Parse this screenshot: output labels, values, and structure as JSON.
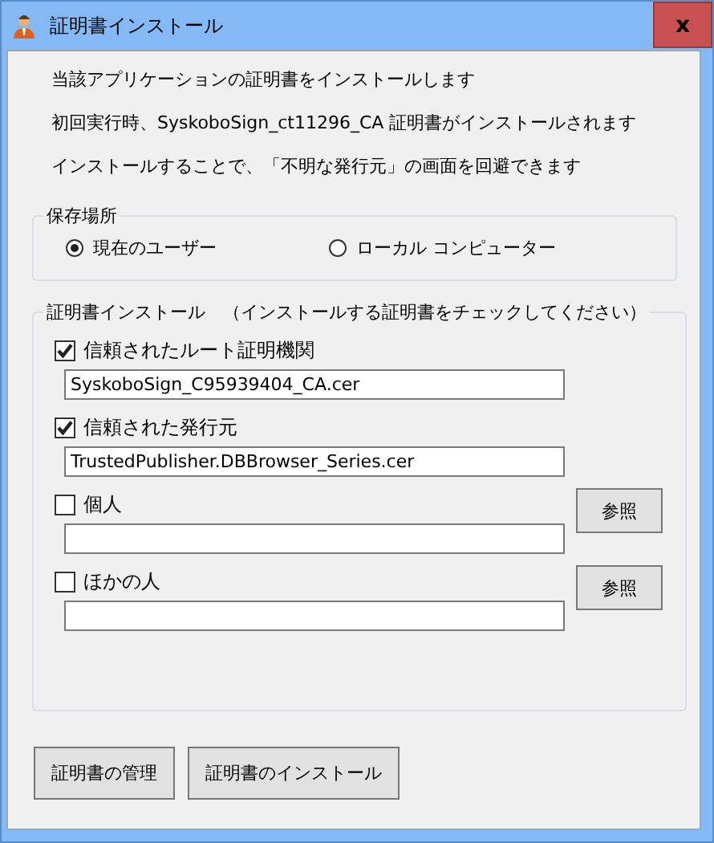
{
  "window": {
    "title": "証明書インストール",
    "close": "x"
  },
  "intro": [
    "当該アプリケーションの証明書をインストールします",
    "初回実行時、SyskoboSign_ct11296_CA 証明書がインストールされます",
    "インストールすることで、「不明な発行元」の画面を回避できます"
  ],
  "location": {
    "title": "保存場所",
    "options": [
      {
        "label": "現在のユーザー",
        "selected": true
      },
      {
        "label": "ローカル コンピューター",
        "selected": false
      }
    ]
  },
  "certs": {
    "title": "証明書インストール　（インストールする証明書をチェックしてください）",
    "items": [
      {
        "kind": "fixed",
        "label": "信頼されたルート証明機関",
        "checked": true,
        "value": "SyskoboSign_C95939404_CA.cer"
      },
      {
        "kind": "fixed",
        "label": "信頼された発行元",
        "checked": true,
        "value": "TrustedPublisher.DBBrowser_Series.cer"
      },
      {
        "kind": "browse",
        "label": "個人",
        "checked": false,
        "button": "参照"
      },
      {
        "kind": "browse",
        "label": "ほかの人",
        "checked": false,
        "button": "参照"
      }
    ]
  },
  "buttons": [
    "証明書の管理",
    "証明書のインストール"
  ]
}
